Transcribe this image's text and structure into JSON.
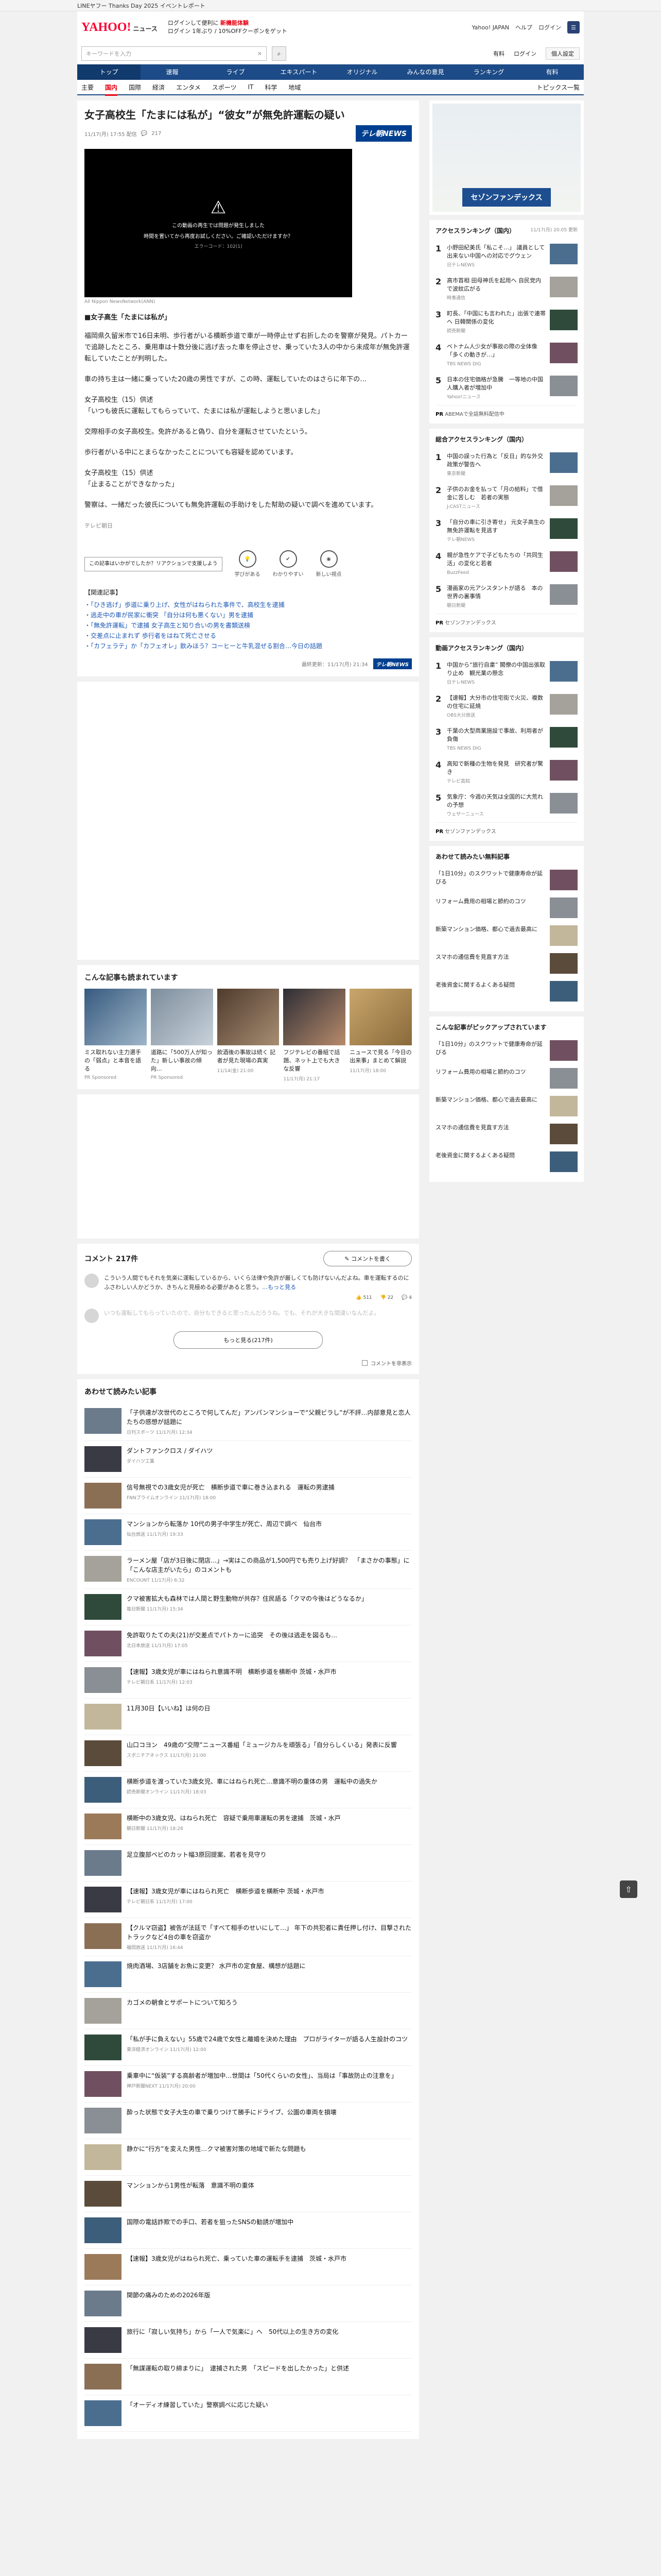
{
  "promo": "LINEヤフー Thanks Day 2025 イベントレポート",
  "header": {
    "logo": "YAHOO!",
    "logo_sub": "ニュース",
    "login_line1": "ログインして便利に",
    "login_line1_red": "新機能体験",
    "login_line2": "ログイン",
    "login_line2_tail": "1年ぶり / 10%OFFクーポンをゲット",
    "right_links": [
      "Yahoo! JAPAN",
      "ヘルプ",
      "ログイン"
    ],
    "search_placeholder": "キーワードを入力",
    "search_right": [
      "有料",
      "ログイン"
    ],
    "search_right_btn": "個人設定"
  },
  "nav_main": [
    "トップ",
    "速報",
    "ライブ",
    "エキスパート",
    "オリジナル",
    "みんなの意見",
    "ランキング",
    "有料"
  ],
  "nav_sub": [
    "主要",
    "国内",
    "国際",
    "経済",
    "エンタメ",
    "スポーツ",
    "IT",
    "科学",
    "地域"
  ],
  "nav_sub_active": "国内",
  "nav_topics": "トピックス一覧",
  "article": {
    "title": "女子高校生「たまには私が」“彼女”が無免許運転の疑い",
    "time": "11/17(月) 17:55 配信",
    "comment_count": "217",
    "source_badge": "テレ朝NEWS",
    "video_msg1": "この動画の再生では問題が発生しました",
    "video_msg2": "時間を置いてから再度お試しください。ご確認いただけますか？",
    "video_err": "エラーコード：102(1)",
    "video_caption": "All Nippon NewsNetwork(ANN)",
    "lead": "■女子高生「たまには私が」",
    "paras": [
      "福岡県久留米市で16日未明、歩行者がいる横断歩道で車が一時停止せず右折したのを警察が発見。パトカーで追跡したところ、乗用車は十数分後に逃げ去った車を停止させ、乗っていた3人の中から未成年が無免許運転していたことが判明した。",
      "車の持ち主は一緒に乗っていた20歳の男性ですが、この時、運転していたのはさらに年下の…",
      "女子高校生（15）供述",
      "「いつも彼氏に運転してもらっていて、たまには私が運転しようと思いました」",
      "交際相手の女子高校生。免許があると偽り、自分を運転させていたという。",
      "歩行者がいる中にとまらなかったことについても容疑を認めています。",
      "女子高校生（15）供述",
      "「止まることができなかった」",
      "警察は、一緒だった彼氏についても無免許運転の手助けをした幇助の疑いで調べを進めています。"
    ],
    "tail_note": "テレビ朝日",
    "react_box_text": "この記事はいかがでしたか？リアクションで支援しよう",
    "reactions": [
      "学びがある",
      "わかりやすい",
      "新しい視点"
    ],
    "related_title": "【関連記事】",
    "related_links": [
      "・「ひき逃げ」歩道に乗り上げ、女性がはねられた事件で、高校生を逮捕",
      "・逃走中の車が民家に衝突 「自分は何も悪くない」男を逮捕",
      "・「無免許運転」で逮捕 女子高生と知り合いの男を書類送検",
      "・交差点に止まれず 歩行者をはねて死亡させる",
      "・「カフェラテ」か「カフェオレ」飲みほう？コーヒーと牛乳混ぜる割合…今日の話題"
    ],
    "source_time": "最終更新：11/17(月) 21:34",
    "source_name": "テレ朝NEWS"
  },
  "recommend": {
    "title": "こんな記事も読まれています",
    "items": [
      {
        "text": "ミス取れない主力選手の「弱点」と本音を語る",
        "src": "PR Sponsored"
      },
      {
        "text": "道路に「500万人が知った」新しい事故の傾向…",
        "src": "PR Sponsored"
      },
      {
        "text": "飲酒後の事故は続く 記者が見た現場の真実",
        "src": "11/14(金) 21:00"
      },
      {
        "text": "フジテレビの番組で話題、ネット上でも大きな反響",
        "src": "11/17(月) 21:17"
      },
      {
        "text": "ニュースで見る「今日の出来事」まとめて解説",
        "src": "11/17(月) 18:00"
      }
    ]
  },
  "comments": {
    "title": "コメント",
    "count": "217件",
    "write_btn": "コメントを書く",
    "items": [
      {
        "text": "こういう人間でもそれを気楽に運転しているから、いくら法律や免許が厳しくても防げないんだよね。車を運転するのにふさわしい人かどうか、きちんと見極める必要があると思う。",
        "more": "…もっと見る",
        "likes": "511",
        "dislikes": "22",
        "replies": "4"
      },
      {
        "text": "いつも運転してもらっていたので、自分もできると思ったんだろうね。でも、それが大きな間違いなんだよ。",
        "more": "",
        "likes": "",
        "dislikes": "",
        "replies": ""
      }
    ],
    "more_btn": "もっと見る(217件)",
    "hide_label": "コメントを非表示"
  },
  "feed_title": "あわせて読みたい記事",
  "feed": [
    {
      "title": "「子供達が次世代のところで何してんだ」アンパンマンショーで“父親ビラし”が不評…内部意見と恋人たちの感想が話題に",
      "src": "日刊スポーツ 11/17(月) 12:34",
      "ad": false
    },
    {
      "title": "ダントファンクロス / ダイハツ",
      "src": "ダイハツ工業",
      "ad": true
    },
    {
      "title": "信号無視での3歳女児が死亡　横断歩道で車に巻き込まれる　運転の男逮捕",
      "src": "FNNプライムオンライン 11/17(月) 18:00",
      "ad": false
    },
    {
      "title": "マンションから転落か 10代の男子中学生が死亡、周辺で調べ　仙台市",
      "src": "仙台放送 11/17(月) 19:33",
      "ad": false
    },
    {
      "title": "ラーメン屋「店が3日後に閉店…」→実はこの商品が1,500円でも売り上げ好調？　「まさかの事態」に「こんな店主がいたら」のコメントも",
      "src": "ENCOUNT 11/17(月) 6:32",
      "ad": false
    },
    {
      "title": "クマ被害拡大も森林では人間と野生動物が共存？住民語る「クマの今後はどうなるか」",
      "src": "毎日新聞 11/17(月) 15:34",
      "ad": false
    },
    {
      "title": "免許取りたての夫(21)が交差点でパトカーに追突　その後は逃走を図るも…",
      "src": "北日本放送 11/17(月) 17:05",
      "ad": false
    },
    {
      "title": "【速報】3歳女児が車にはねられ意識不明　横断歩道を横断中 茨城・水戸市",
      "src": "テレビ朝日系 11/17(月) 12:03",
      "ad": false
    },
    {
      "title": "11月30日【いいね】は何の日",
      "src": "",
      "ad": true
    },
    {
      "title": "山口コヨン　49歳の“交際”ニュース番組「ミュージカルを頑張る」「自分らしくいる」発表に反響",
      "src": "スポニチアネックス 11/17(月) 21:00",
      "ad": false
    },
    {
      "title": "横断歩道を渡っていた3歳女児、車にはねられ死亡…意識不明の重体の男　運転中の過失か",
      "src": "読売新聞オンライン 11/17(月) 18:03",
      "ad": false
    },
    {
      "title": "横断中の3歳女児、はねられ死亡　容疑で乗用車運転の男を逮捕　茨城・水戸",
      "src": "朝日新聞 11/17(月) 18:28",
      "ad": false
    },
    {
      "title": "足立腹部ベビのカット幅3原回提案、若者を見守り",
      "src": "",
      "ad": true
    },
    {
      "title": "【速報】3歳女児が車にはねられ死亡　横断歩道を横断中 茨城・水戸市",
      "src": "テレビ朝日系 11/17(月) 17:00",
      "ad": false
    },
    {
      "title": "【クルマ窃盗】被告が法廷で「すべて相手のせいにして…」 年下の共犯者に責任押し付け、目撃されたトラックなど4台の車を窃盗か",
      "src": "福岡放送 11/17(月) 16:44",
      "ad": false
    },
    {
      "title": "焼肉酒場、3店舗をお魚に変更？ 水戸市の定食屋、構想が話題に",
      "src": "",
      "ad": true
    },
    {
      "title": "カゴメの朝食とサポートについて知ろう",
      "src": "",
      "ad": true
    },
    {
      "title": "「私が手に負えない」55歳で24歳で女性と離婚を決めた理由　プロがライターが語る人生設計のコツ",
      "src": "東洋経済オンライン 11/17(月) 12:00",
      "ad": false
    },
    {
      "title": "乗車中に“仮装”する高齢者が増加中…世間は「50代くらいの女性」、当局は「事故防止の注意を」",
      "src": "神戸新聞NEXT 11/17(月) 20:00",
      "ad": false
    },
    {
      "title": "酔った状態で女子大生の車で乗りつけて勝手にドライブ、公園の車両を損壊",
      "src": "",
      "ad": false
    },
    {
      "title": "静かに“行方”を変えた男性…クマ被害対策の地域で新たな問題も",
      "src": "",
      "ad": true
    },
    {
      "title": "マンションから1男性が転落　意識不明の重体",
      "src": "",
      "ad": false
    },
    {
      "title": "国際の電話詐欺での手口、若者を狙ったSNSの勧誘が増加中",
      "src": "",
      "ad": false
    },
    {
      "title": "【速報】3歳女児がはねられ死亡、乗っていた車の運転手を逮捕　茨城・水戸市",
      "src": "",
      "ad": false
    },
    {
      "title": "関節の痛みのための2026年版",
      "src": "",
      "ad": true
    },
    {
      "title": "旅行に「寂しい気持ち」から「一人で気楽に」へ　50代以上の生き方の変化",
      "src": "",
      "ad": false
    },
    {
      "title": "「無謀運転の取り締まりに」　逮捕された男　「スピードを出したかった」と供述",
      "src": "",
      "ad": false
    },
    {
      "title": "「オーディオ練習していた」警察調べに応じた疑い",
      "src": "",
      "ad": false
    }
  ],
  "sidebar": {
    "ad_logo": "セゾンファンデックス",
    "rank1_title": "アクセスランキング（国内）",
    "rank1_sub": "11/17(月) 20:05 更新",
    "rank1": [
      {
        "t": "小野田紀美氏「私こそ…」 議員として出来ない中国への対応でグウェン",
        "src": "日テレNEWS"
      },
      {
        "t": "高市首相 田母神氏を起用へ 自民党内で波紋広がる",
        "src": "時事通信"
      },
      {
        "t": "町長、「中国にも言われた」出張で連帯へ 日韓関係の変化",
        "src": "読売新聞"
      },
      {
        "t": "ベトナム人少女が事故の際の全体像「多くの動きが…」",
        "src": "TBS NEWS DIG"
      },
      {
        "t": "日本の住宅価格が急騰　一等地の中国人購入者が増加中",
        "src": "Yahoo!ニュース"
      }
    ],
    "rank1_pr": "ABEMAで全話無料配信中",
    "rank2_title": "総合アクセスランキング（国内）",
    "rank2": [
      {
        "t": "中国の誤った行為と「反日」的な外交政策が警告へ",
        "src": "東京新聞"
      },
      {
        "t": "子供のお金を払って「月の給料」で借金に苦しむ　若者の実態",
        "src": "J-CASTニュース"
      },
      {
        "t": "「自分の車に引き寄せ」 元女子高生の無免許運転を見逃す",
        "src": "テレ朝NEWS"
      },
      {
        "t": "親が急性ケアで子どもたちの「共同生活」の変化と若者",
        "src": "BuzzFeed"
      },
      {
        "t": "漫画家の元アシスタントが語る　本の世界の裏事情",
        "src": "朝日新聞"
      }
    ],
    "rank3_title": "動画アクセスランキング（国内）",
    "rank3": [
      {
        "t": "中国から“旅行自粛” 閣僚の中国出張取り止め　観光業の懸念",
        "src": "日テレNEWS"
      },
      {
        "t": "【速報】大分市の住宅街で火災、複数の住宅に延焼",
        "src": "OBS大分放送"
      },
      {
        "t": "千葉の大型商業施設で事故、利用者が負傷",
        "src": "TBS NEWS DIG"
      },
      {
        "t": "高知で新種の生物を発見　研究者が驚き",
        "src": "テレビ高知"
      },
      {
        "t": "気象庁：今週の天気は全国的に大荒れの予想",
        "src": "ウェザーニュース"
      }
    ],
    "rank4_title": "あわせて読みたい無料記事",
    "rank5_title": "こんな記事がピックアップされています",
    "extra": [
      "「1日10分」のスクワットで健康寿命が延びる",
      "リフォーム費用の相場と節約のコツ",
      "新築マンション価格、都心で過去最高に",
      "スマホの通信費を見直す方法",
      "老後資金に関するよくある疑問"
    ],
    "pr_label": "PR",
    "pr_sponsor": "セゾンファンデックス"
  }
}
